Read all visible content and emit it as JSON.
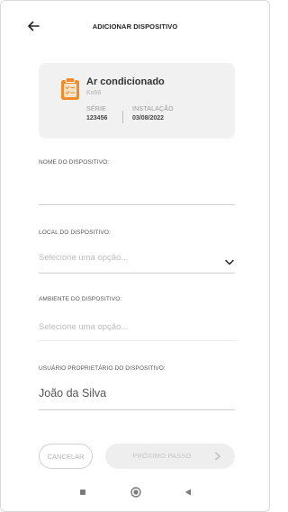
{
  "header": {
    "title": "ADICIONAR DISPOSITIVO",
    "back_icon": "arrow-left-icon"
  },
  "device_card": {
    "icon": "clipboard-check-icon",
    "icon_color": "#f08c2c",
    "name": "Ar condicionado",
    "code": "Ko56",
    "serie_label": "SÉRIE",
    "serie_value": "123456",
    "installation_label": "INSTALAÇÃO",
    "installation_value": "03/08/2022"
  },
  "form": {
    "device_name": {
      "label": "NOME DO DISPOSITIVO:",
      "value": ""
    },
    "device_location": {
      "label": "LOCAL DO DISPOSITIVO:",
      "placeholder": "Selecione uma opção..."
    },
    "device_environment": {
      "label": "AMBIENTE DO DISPOSITIVO:",
      "placeholder": "Selecione uma opção..."
    },
    "device_owner": {
      "label": "USUÁRIO PROPRIETÁRIO DO DISPOSITIVO:",
      "value": "João da Silva"
    }
  },
  "actions": {
    "cancel_label": "CANCELAR",
    "next_label": "PRÓXIMO PASSO"
  },
  "system_nav": {
    "icons": [
      "square-icon",
      "circle-icon",
      "triangle-back-icon"
    ]
  }
}
